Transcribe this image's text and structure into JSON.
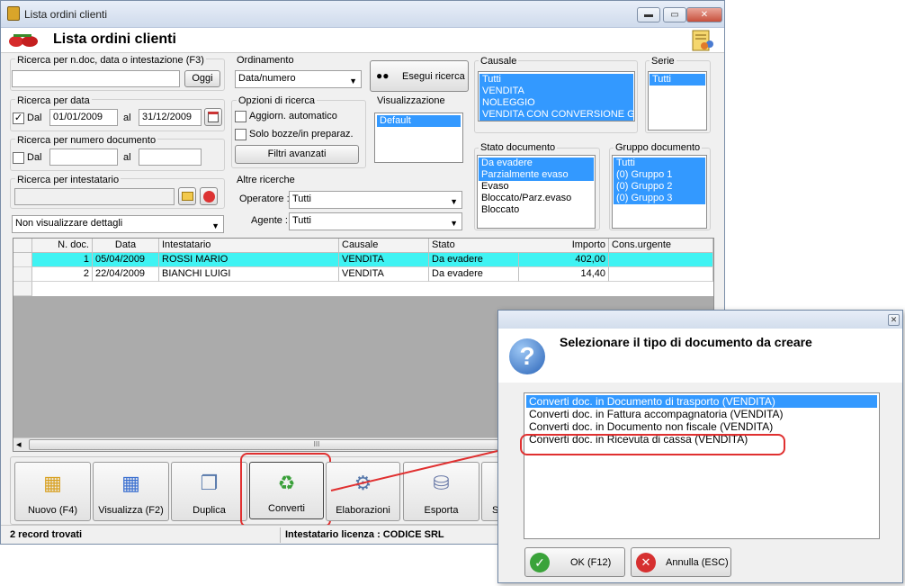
{
  "window": {
    "title": "Lista ordini clienti",
    "header": "Lista ordini clienti",
    "min_glyph": "▬",
    "max_glyph": "▭",
    "close_glyph": "✕"
  },
  "search": {
    "general_label": "Ricerca per n.doc, data o intestazione (F3)",
    "general_value": "",
    "ok_label": "Oggi",
    "date_label": "Ricerca per data",
    "date_checked_glyph": "✓",
    "date_dal": "Dal",
    "date_from": "01/01/2009",
    "date_al": "al",
    "date_to": "31/12/2009",
    "num_label": "Ricerca per numero documento",
    "num_dal": "Dal",
    "num_al": "al",
    "num_from": "",
    "num_to": "",
    "holder_label": "Ricerca per intestatario",
    "holder_value": "",
    "detail_combo": "Non visualizzare dettagli"
  },
  "ordering": {
    "label": "Ordinamento",
    "value": "Data/numero",
    "run_label": "Esegui ricerca"
  },
  "options": {
    "label": "Opzioni di ricerca",
    "auto": "Aggiorn. automatico",
    "drafts": "Solo bozze/in preparaz.",
    "filters": "Filtri avanzati"
  },
  "visualizzazione": {
    "label": "Visualizzazione",
    "items": [
      "Default"
    ]
  },
  "other": {
    "label": "Altre ricerche",
    "operator_label": "Operatore :",
    "operator_value": "Tutti",
    "agent_label": "Agente :",
    "agent_value": "Tutti"
  },
  "causale": {
    "label": "Causale",
    "items": [
      "Tutti",
      "VENDITA",
      "NOLEGGIO",
      "VENDITA CON CONVERSIONE GL"
    ]
  },
  "serie": {
    "label": "Serie",
    "items": [
      "Tutti"
    ]
  },
  "stato": {
    "label": "Stato documento",
    "items": [
      "Da evadere",
      "Parzialmente evaso",
      "Evaso",
      "Bloccato/Parz.evaso",
      "Bloccato"
    ]
  },
  "gruppo": {
    "label": "Gruppo documento",
    "items": [
      "Tutti",
      "(0) Gruppo 1",
      "(0) Gruppo 2",
      "(0) Gruppo 3"
    ]
  },
  "grid": {
    "columns": [
      "N. doc.",
      "Data",
      "Intestatario",
      "Causale",
      "Stato",
      "Importo",
      "Cons.urgente"
    ],
    "rows": [
      [
        "1",
        "05/04/2009",
        "ROSSI MARIO",
        "VENDITA",
        "Da evadere",
        "402,00",
        ""
      ],
      [
        "2",
        "22/04/2009",
        "BIANCHI LUIGI",
        "VENDITA",
        "Da evadere",
        "14,40",
        ""
      ]
    ],
    "scroll_left": "◂",
    "scroll_thumb": "III"
  },
  "toolbar": {
    "nuovo": "Nuovo (F4)",
    "visualizza": "Visualizza (F2)",
    "duplica": "Duplica",
    "converti": "Converti",
    "elaborazioni": "Elaborazioni",
    "esporta": "Esporta",
    "stampa": "S"
  },
  "status": {
    "records": "2 record trovati",
    "license": "Intestatario licenza : CODICE SRL"
  },
  "dialog": {
    "close_glyph": "✕",
    "question_glyph": "?",
    "title": "Selezionare il tipo di documento da creare",
    "options": [
      "Converti doc. in Documento di trasporto (VENDITA)",
      "Converti doc. in Fattura accompagnatoria (VENDITA)",
      "Converti doc. in Documento non fiscale (VENDITA)",
      "Converti doc. in Ricevuta di cassa (VENDITA)"
    ],
    "ok_glyph": "✓",
    "cancel_glyph": "✕",
    "ok": "OK (F12)",
    "cancel": "Annulla (ESC)"
  }
}
